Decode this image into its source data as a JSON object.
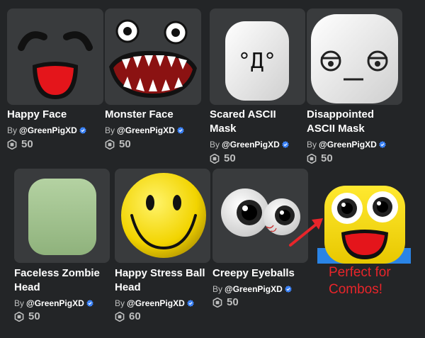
{
  "by_prefix": "By",
  "items": [
    {
      "name": "Happy Face",
      "creator": "@GreenPigXD",
      "price": "50"
    },
    {
      "name": "Monster Face",
      "creator": "@GreenPigXD",
      "price": "50"
    },
    {
      "name": "Scared ASCII Mask",
      "creator": "@GreenPigXD",
      "price": "50",
      "glyphs": "°Д°"
    },
    {
      "name": "Disappointed ASCII Mask",
      "creator": "@GreenPigXD",
      "price": "50"
    },
    {
      "name": "Faceless Zombie Head",
      "creator": "@GreenPigXD",
      "price": "50"
    },
    {
      "name": "Happy Stress Ball Head",
      "creator": "@GreenPigXD",
      "price": "60"
    },
    {
      "name": "Creepy Eyeballs",
      "creator": "@GreenPigXD",
      "price": "50"
    }
  ],
  "annotation": "Perfect for Combos!",
  "colors": {
    "background": "#232527",
    "tile": "#393b3d",
    "verified": "#3b82f6",
    "annotation": "#e8252a"
  }
}
